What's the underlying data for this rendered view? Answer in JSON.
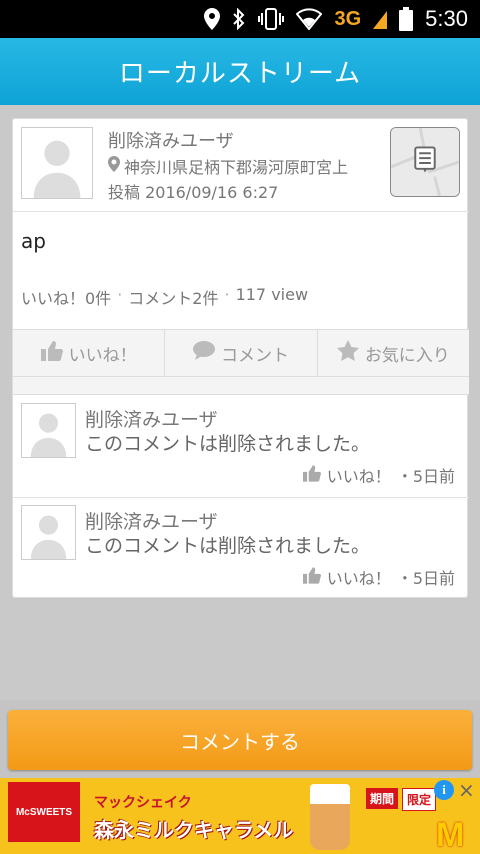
{
  "status_bar": {
    "network": "3G",
    "time": "5:30",
    "icons": [
      "location-icon",
      "bluetooth-icon",
      "vibrate-icon",
      "wifi-icon",
      "signal-icon",
      "battery-icon"
    ]
  },
  "header": {
    "title": "ローカルストリーム"
  },
  "post": {
    "user": "削除済みユーザ",
    "location": "神奈川県足柄下郡湯河原町宮上",
    "date": "投稿 2016/09/16 6:27",
    "body": "ap",
    "stats": {
      "likes": "いいね！0件",
      "comments": "コメント2件",
      "views": "117 view",
      "separator": "·"
    },
    "actions": {
      "like": "いいね！",
      "comment": "コメント",
      "favorite": "お気に入り"
    }
  },
  "comments": [
    {
      "user": "削除済みユーザ",
      "text": "このコメントは削除されました。",
      "like": "いいね！",
      "time": "・5日前"
    },
    {
      "user": "削除済みユーザ",
      "text": "このコメントは削除されました。",
      "like": "いいね！",
      "time": "・5日前"
    }
  ],
  "comment_button": {
    "label": "コメントする"
  },
  "ad": {
    "brand": "McSWEETS",
    "line1": "マックシェイク",
    "line2": "森永ミルクキャラメル",
    "badge1": "期間",
    "badge2": "限定",
    "info": "i",
    "close": "×",
    "logo": "M"
  },
  "colors": {
    "header": "#0ea3d6",
    "button": "#f39a16",
    "background": "#c9c9c9"
  }
}
